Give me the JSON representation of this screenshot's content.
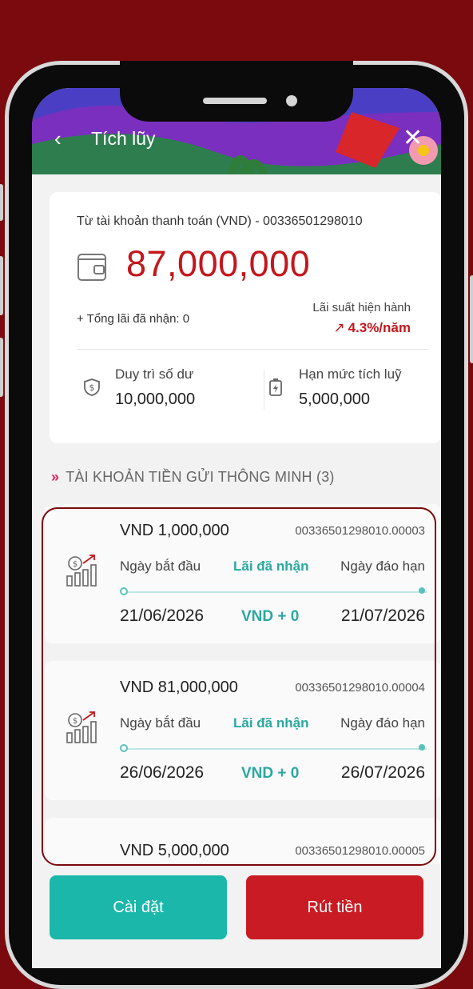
{
  "header": {
    "title": "Tích lũy",
    "back_icon": "chevron-left-icon",
    "close_icon": "close-icon"
  },
  "balance_card": {
    "from_account": "Từ tài khoản thanh toán (VND) - 00336501298010",
    "balance": "87,000,000",
    "interest_received": "+ Tổng lãi đã nhận: 0",
    "rate_label": "Lãi suất hiện hành",
    "rate_value": "4.3%/năm",
    "maintain_label": "Duy trì số dư",
    "maintain_value": "10,000,000",
    "limit_label": "Hạn mức tích luỹ",
    "limit_value": "5,000,000"
  },
  "section_title": "TÀI KHOẢN TIỀN GỬI THÔNG MINH (3)",
  "deposits": [
    {
      "amount": "VND 1,000,000",
      "number": "00336501298010.00003",
      "start_label": "Ngày bắt đầu",
      "interest_label": "Lãi đã nhận",
      "end_label": "Ngày đáo hạn",
      "start_date": "21/06/2026",
      "interest_value": "VND + 0",
      "end_date": "21/07/2026"
    },
    {
      "amount": "VND 81,000,000",
      "number": "00336501298010.00004",
      "start_label": "Ngày bắt đầu",
      "interest_label": "Lãi đã nhận",
      "end_label": "Ngày đáo hạn",
      "start_date": "26/06/2026",
      "interest_value": "VND + 0",
      "end_date": "26/07/2026"
    },
    {
      "amount": "VND 5,000,000",
      "number": "00336501298010.00005"
    }
  ],
  "buttons": {
    "settings": "Cài đặt",
    "withdraw": "Rút tiền"
  },
  "colors": {
    "brand_red": "#c4161c",
    "teal": "#1ab7aa",
    "background": "#7a0a0e"
  }
}
